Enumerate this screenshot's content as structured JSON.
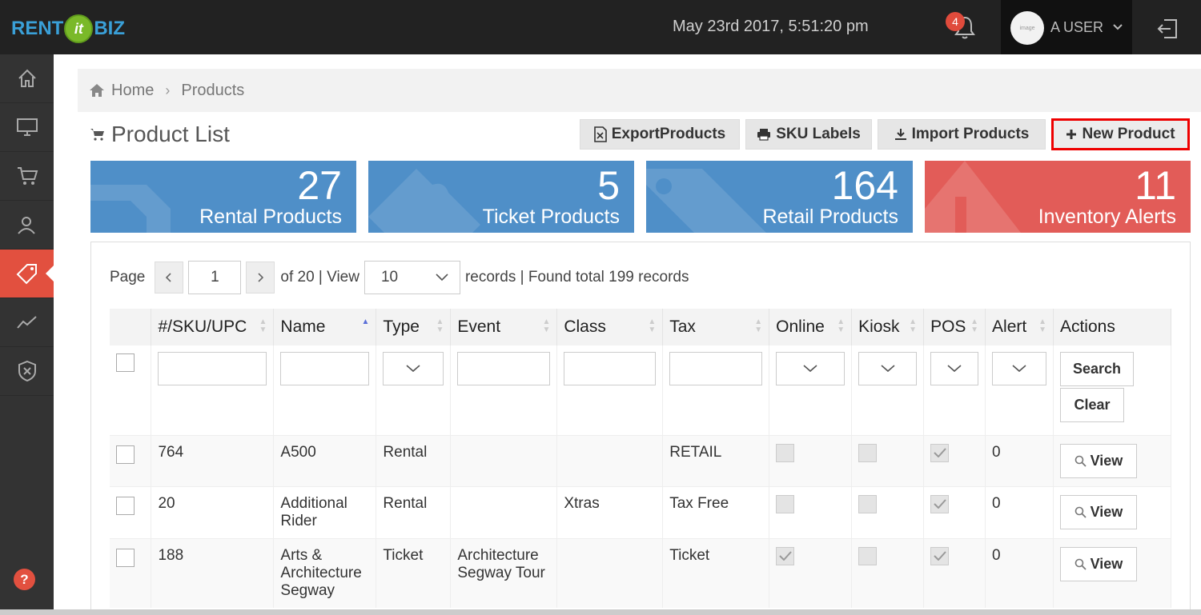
{
  "brand": {
    "part1": "RENT",
    "part2": "it",
    "part3": "BIZ"
  },
  "header": {
    "datetime": "May 23rd 2017, 5:51:20 pm",
    "notification_count": "4",
    "user_name": "A USER",
    "avatar_text": "image"
  },
  "sidebar": {
    "items": [
      "home",
      "monitor",
      "cart",
      "customers",
      "products",
      "reports",
      "security"
    ],
    "help": "?"
  },
  "breadcrumb": {
    "home": "Home",
    "current": "Products"
  },
  "page_title": "Product List",
  "toolbar": {
    "export": "ExportProducts",
    "sku": "SKU Labels",
    "import": "Import Products",
    "new": "New Product"
  },
  "stats": [
    {
      "value": "27",
      "label": "Rental Products",
      "color": "#4f8fc8"
    },
    {
      "value": "5",
      "label": "Ticket Products",
      "color": "#4f8fc8"
    },
    {
      "value": "164",
      "label": "Retail Products",
      "color": "#4f8fc8"
    },
    {
      "value": "11",
      "label": "Inventory Alerts",
      "color": "#e25c58"
    }
  ],
  "pager": {
    "page_label": "Page",
    "page": "1",
    "of_text": "of 20 | View",
    "per_page": "10",
    "records_text": "records | Found total 199 records"
  },
  "columns": [
    "#/SKU/UPC",
    "Name",
    "Type",
    "Event",
    "Class",
    "Tax",
    "Online",
    "Kiosk",
    "POS",
    "Alert",
    "Actions"
  ],
  "filter_actions": {
    "search": "Search",
    "clear": "Clear"
  },
  "rows": [
    {
      "sku": "764",
      "name": "A500",
      "type": "Rental",
      "event": "",
      "class": "",
      "tax": "RETAIL",
      "online": false,
      "kiosk": false,
      "pos": true,
      "alert": "0",
      "action": "View"
    },
    {
      "sku": "20",
      "name": "Additional Rider",
      "type": "Rental",
      "event": "",
      "class": "Xtras",
      "tax": "Tax Free",
      "online": false,
      "kiosk": false,
      "pos": true,
      "alert": "0",
      "action": "View"
    },
    {
      "sku": "188",
      "name": "Arts & Architecture Segway",
      "type": "Ticket",
      "event": "Architecture Segway Tour",
      "class": "",
      "tax": "Ticket",
      "online": true,
      "kiosk": false,
      "pos": true,
      "alert": "0",
      "action": "View"
    }
  ]
}
